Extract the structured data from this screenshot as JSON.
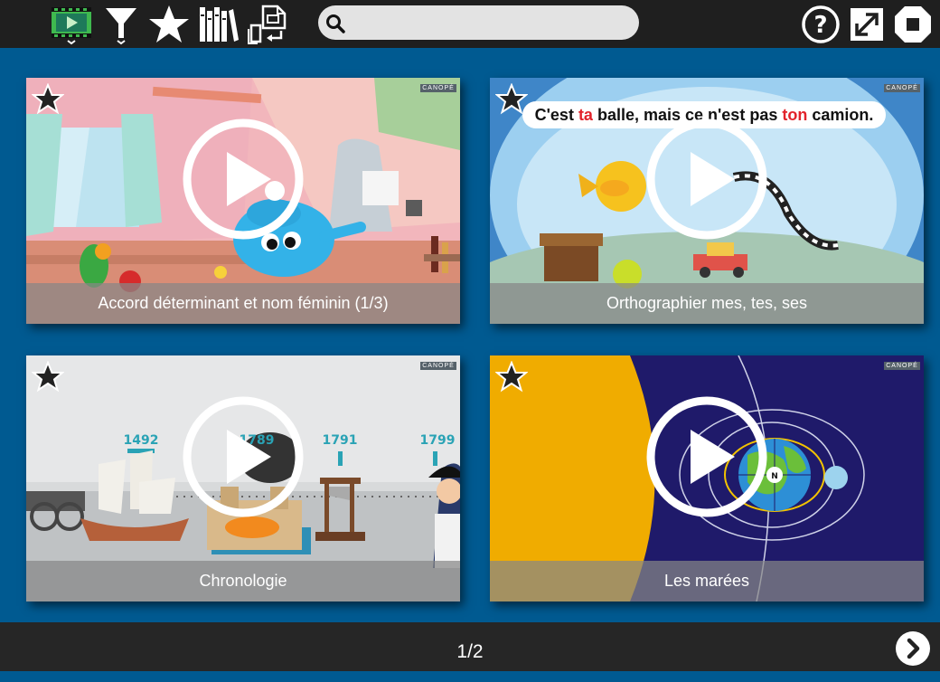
{
  "toolbar": {
    "icons": [
      "video-icon",
      "filter-icon",
      "favorites-star-icon",
      "library-icon",
      "import-export-icon"
    ],
    "search": {
      "value": "",
      "placeholder": ""
    },
    "right_icons": [
      "help-icon",
      "fullscreen-icon",
      "stop-icon"
    ]
  },
  "videos": [
    {
      "title": "Accord déterminant et nom féminin (1/3)",
      "badge": "CANOPÉ"
    },
    {
      "title": "Orthographier mes, tes, ses",
      "badge": "CANOPÉ",
      "subtitle": {
        "a": "C'est ",
        "b": "ta",
        "c": " balle, mais ce n'est pas ",
        "d": "ton",
        "e": " camion."
      }
    },
    {
      "title": "Chronologie",
      "badge": "CANOPÉ",
      "years": [
        "1492",
        "1789",
        "1791",
        "1799"
      ]
    },
    {
      "title": "Les marées",
      "badge": "CANOPÉ",
      "marker": "N"
    }
  ],
  "pagination": {
    "label": "1/2"
  },
  "colors": {
    "background": "#005a91",
    "toolbar": "#1f1f1f",
    "accent_green": "#3fb94f",
    "footer": "#262626"
  }
}
